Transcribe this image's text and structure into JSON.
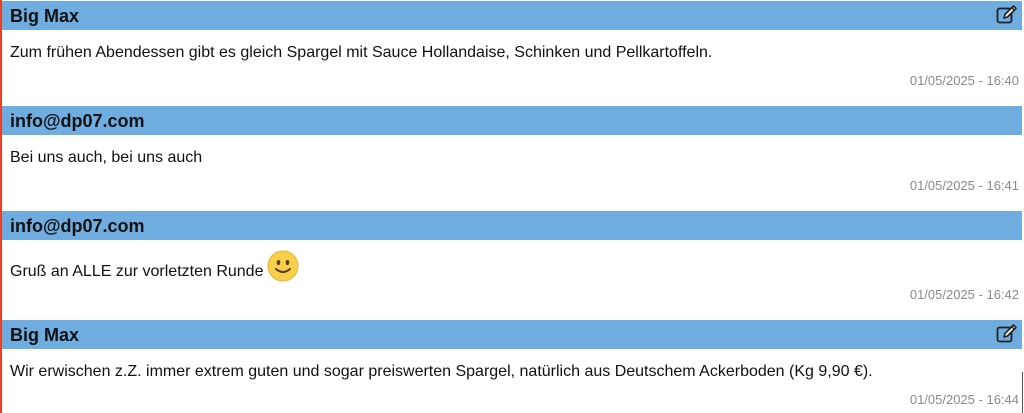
{
  "posts": [
    {
      "author": "Big Max",
      "message": "Zum frühen Abendessen gibt es gleich Spargel mit Sauce Hollandaise, Schinken und Pellkartoffeln.",
      "timestamp": "01/05/2025 - 16:40",
      "editable": true
    },
    {
      "author": "info@dp07.com",
      "message": "Bei uns auch, bei uns auch",
      "timestamp": "01/05/2025 - 16:41",
      "editable": false
    },
    {
      "author": "info@dp07.com",
      "message": "Gruß an ALLE zur vorletzten Runde",
      "timestamp": "01/05/2025 - 16:42",
      "editable": false,
      "emoji": "smiley-icon"
    },
    {
      "author": "Big Max",
      "message": "Wir erwischen z.Z. immer extrem guten und sogar preiswerten Spargel, natürlich aus Deutschem Ackerboden (Kg 9,90 €).",
      "timestamp": "01/05/2025 - 16:44",
      "editable": true
    }
  ],
  "colors": {
    "header_bg": "#6fade0",
    "accent_rule": "#e0432b",
    "timestamp": "#8a8a8a",
    "emoji": "#f7cf4a"
  }
}
